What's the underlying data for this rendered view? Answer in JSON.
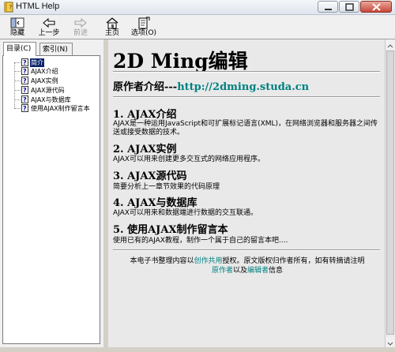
{
  "window": {
    "title": "HTML Help"
  },
  "toolbar": {
    "hide": "隐藏",
    "back": "上一步",
    "forward": "前进",
    "home": "主页",
    "options": "选项(O)"
  },
  "tabs": {
    "contents": "目录(C)",
    "index": "索引(N)"
  },
  "tree": [
    {
      "label": "简介",
      "selected": true
    },
    {
      "label": "AJAX介绍"
    },
    {
      "label": "AJAX实例"
    },
    {
      "label": "AJAX源代码"
    },
    {
      "label": "AJAX与数据库"
    },
    {
      "label": "使用AJAX制作留言本"
    }
  ],
  "content": {
    "title": "2D Ming编辑",
    "author_label": "原作者介绍---",
    "author_link": "http://2dming.studa.cn",
    "sections": [
      {
        "heading": "1. AJAX介绍",
        "text": "AJAX是一种运用JavaScript和可扩展标记语言(XML)，在网络浏览器和服务器之间传送或接受数据的技术。"
      },
      {
        "heading": "2. AJAX实例",
        "text": "AJAX可以用来创建更多交互式的网络应用程序。"
      },
      {
        "heading": "3. AJAX源代码",
        "text": "简要分析上一章节效果的代码原理"
      },
      {
        "heading": "4. AJAX与数据库",
        "text": "AJAX可以用来和数据端进行数据的交互联通。"
      },
      {
        "heading": "5. 使用AJAX制作留言本",
        "text": "使用已有的AJAX教程，制作一个属于自己的留言本吧...."
      }
    ],
    "footer": {
      "part1": "本电子书整理内容以",
      "link1": "创作共用",
      "part2": "授权。原文版权归作者所有，如有转摘请注明",
      "link2": "原作者",
      "part3": "以及",
      "link3": "编辑者",
      "part4": "信息"
    }
  },
  "colors": {
    "link": "#008080",
    "selection": "#0a246a"
  }
}
